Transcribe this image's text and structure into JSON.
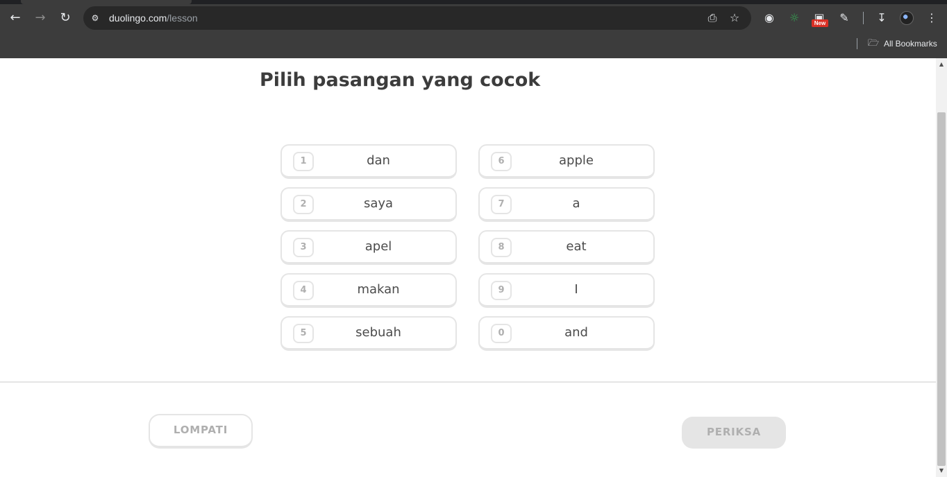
{
  "browser": {
    "url_host": "duolingo.com",
    "url_path": "/lesson",
    "new_badge": "New",
    "bookmarks_label": "All Bookmarks"
  },
  "lesson": {
    "title": "Pilih pasangan yang cocok",
    "left_tiles": [
      {
        "num": "1",
        "word": "dan"
      },
      {
        "num": "2",
        "word": "saya"
      },
      {
        "num": "3",
        "word": "apel"
      },
      {
        "num": "4",
        "word": "makan"
      },
      {
        "num": "5",
        "word": "sebuah"
      }
    ],
    "right_tiles": [
      {
        "num": "6",
        "word": "apple"
      },
      {
        "num": "7",
        "word": "a"
      },
      {
        "num": "8",
        "word": "eat"
      },
      {
        "num": "9",
        "word": "I"
      },
      {
        "num": "0",
        "word": "and"
      }
    ]
  },
  "footer": {
    "skip_label": "LOMPATI",
    "check_label": "PERIKSA"
  }
}
